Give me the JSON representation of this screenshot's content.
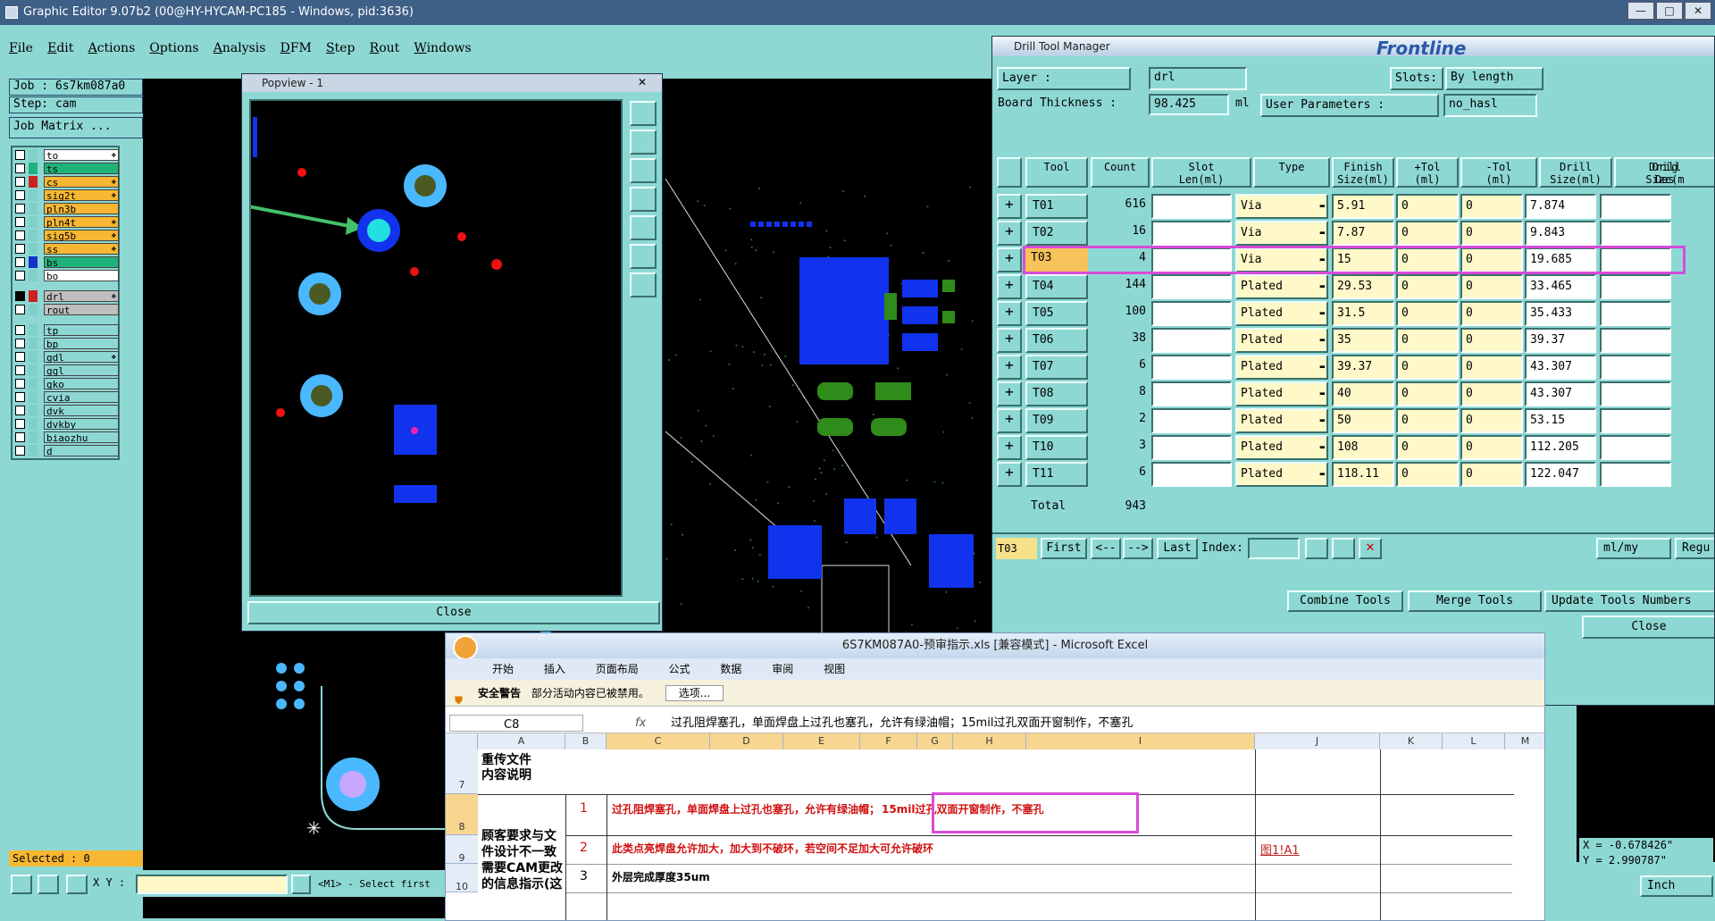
{
  "window": {
    "title": "Graphic Editor 9.07b2 (00@HY-HYCAM-PC185 - Windows, pid:3636)",
    "controls": [
      "—",
      "□",
      "✕"
    ]
  },
  "menu": [
    "File",
    "Edit",
    "Actions",
    "Options",
    "Analysis",
    "DFM",
    "Step",
    "Rout",
    "Windows"
  ],
  "job_info": {
    "job": "Job : 6s7km087a0",
    "step": "Step: cam",
    "matrix_button": "Job Matrix ..."
  },
  "layers": [
    {
      "name": "to",
      "color": "#ffffff",
      "sw": "#7fd0c8",
      "mark": "❖"
    },
    {
      "name": "ts",
      "color": "#1fb27a",
      "sw": "#1fb27a",
      "mark": ""
    },
    {
      "name": "cs",
      "color": "#f7b733",
      "sw": "#cc2222",
      "mark": "❖"
    },
    {
      "name": "sig2t",
      "color": "#f7b733",
      "sw": "#7fd0c8",
      "mark": "❖"
    },
    {
      "name": "pln3b",
      "color": "#f7b733",
      "sw": "#7fd0c8",
      "mark": ""
    },
    {
      "name": "pln4t",
      "color": "#f7b733",
      "sw": "#7fd0c8",
      "mark": "❖"
    },
    {
      "name": "sig5b",
      "color": "#f7b733",
      "sw": "#7fd0c8",
      "mark": "❖"
    },
    {
      "name": "ss",
      "color": "#f7b733",
      "sw": "#7fd0c8",
      "mark": "❖"
    },
    {
      "name": "bs",
      "color": "#1fb27a",
      "sw": "#1133cc",
      "mark": ""
    },
    {
      "name": "bo",
      "color": "#ffffff",
      "sw": "#7fd0c8",
      "mark": ""
    },
    {
      "name": "drl",
      "color": "#bfbfbf",
      "sw": "#cc2222",
      "mark": "❖"
    },
    {
      "name": "rout",
      "color": "#bfbfbf",
      "sw": "#7fd0c8",
      "mark": ""
    },
    {
      "name": "tp",
      "color": "#8ed8d4",
      "sw": "#7fd0c8",
      "mark": ""
    },
    {
      "name": "bp",
      "color": "#8ed8d4",
      "sw": "#7fd0c8",
      "mark": ""
    },
    {
      "name": "gdl",
      "color": "#8ed8d4",
      "sw": "#7fd0c8",
      "mark": "❖"
    },
    {
      "name": "ggl",
      "color": "#8ed8d4",
      "sw": "#7fd0c8",
      "mark": ""
    },
    {
      "name": "gko",
      "color": "#8ed8d4",
      "sw": "#7fd0c8",
      "mark": ""
    },
    {
      "name": "cvia",
      "color": "#8ed8d4",
      "sw": "#7fd0c8",
      "mark": ""
    },
    {
      "name": "dvk",
      "color": "#8ed8d4",
      "sw": "#7fd0c8",
      "mark": ""
    },
    {
      "name": "dvkby",
      "color": "#8ed8d4",
      "sw": "#7fd0c8",
      "mark": ""
    },
    {
      "name": "biaozhu",
      "color": "#8ed8d4",
      "sw": "#7fd0c8",
      "mark": ""
    },
    {
      "name": "d",
      "color": "#8ed8d4",
      "sw": "#7fd0c8",
      "mark": ""
    }
  ],
  "status": {
    "selected": "Selected : 0",
    "xy_label": "X Y :",
    "xy_value": "",
    "prompt": "<M1> - Select first"
  },
  "popview": {
    "title": "Popview - 1",
    "close_x": "✕",
    "close_button": "Close"
  },
  "drill": {
    "title": "Drill Tool Manager",
    "logo_text": "Frontline",
    "layer_label": "Layer          :",
    "layer_value": "drl",
    "slots_label": "Slots:",
    "slots_value": "By length",
    "board_thickness_label": "Board Thickness :",
    "board_thickness_value": "98.425",
    "board_thickness_unit": "ml",
    "user_params_label": "User Parameters :",
    "user_params_value": "no_hasl",
    "headers": [
      "Tool",
      "Count",
      "Slot\nLen(ml)",
      "Type",
      "Finish\nSize(ml)",
      "+Tol\n(ml)",
      "-Tol\n(ml)",
      "Drill\nSize(ml)",
      "Drill\nDes",
      "Orig\nSize(m"
    ],
    "rows": [
      {
        "tool": "T01",
        "count": "616",
        "type": "Via",
        "finish": "5.91",
        "ptol": "0",
        "ntol": "0",
        "drill": "7.874"
      },
      {
        "tool": "T02",
        "count": "16",
        "type": "Via",
        "finish": "7.87",
        "ptol": "0",
        "ntol": "0",
        "drill": "9.843"
      },
      {
        "tool": "T03",
        "count": "4",
        "type": "Via",
        "finish": "15",
        "ptol": "0",
        "ntol": "0",
        "drill": "19.685"
      },
      {
        "tool": "T04",
        "count": "144",
        "type": "Plated",
        "finish": "29.53",
        "ptol": "0",
        "ntol": "0",
        "drill": "33.465"
      },
      {
        "tool": "T05",
        "count": "100",
        "type": "Plated",
        "finish": "31.5",
        "ptol": "0",
        "ntol": "0",
        "drill": "35.433"
      },
      {
        "tool": "T06",
        "count": "38",
        "type": "Plated",
        "finish": "35",
        "ptol": "0",
        "ntol": "0",
        "drill": "39.37"
      },
      {
        "tool": "T07",
        "count": "6",
        "type": "Plated",
        "finish": "39.37",
        "ptol": "0",
        "ntol": "0",
        "drill": "43.307"
      },
      {
        "tool": "T08",
        "count": "8",
        "type": "Plated",
        "finish": "40",
        "ptol": "0",
        "ntol": "0",
        "drill": "43.307"
      },
      {
        "tool": "T09",
        "count": "2",
        "type": "Plated",
        "finish": "50",
        "ptol": "0",
        "ntol": "0",
        "drill": "53.15"
      },
      {
        "tool": "T10",
        "count": "3",
        "type": "Plated",
        "finish": "108",
        "ptol": "0",
        "ntol": "0",
        "drill": "112.205"
      },
      {
        "tool": "T11",
        "count": "6",
        "type": "Plated",
        "finish": "118.11",
        "ptol": "0",
        "ntol": "0",
        "drill": "122.047"
      }
    ],
    "total_label": "Total",
    "total_value": "943",
    "nav": {
      "current": "T03",
      "first": "First",
      "prev": "<--",
      "next": "-->",
      "last": "Last",
      "index_label": "Index:",
      "units": "ml/my",
      "regu": "Regu"
    },
    "buttons": {
      "combine": "Combine Tools",
      "merge": "Merge Tools",
      "update": "Update Tools Numbers",
      "close": "Close"
    },
    "coords": {
      "x": "X = -0.678426\"",
      "y": "Y =  2.990787\""
    },
    "inch": "Inch"
  },
  "excel": {
    "title": "6S7KM087A0-预审指示.xls  [兼容模式] - Microsoft Excel",
    "tabs": [
      "开始",
      "插入",
      "页面布局",
      "公式",
      "数据",
      "审阅",
      "视图"
    ],
    "warning_title": "安全警告",
    "warning_text": "部分活动内容已被禁用。",
    "options_button": "选项...",
    "cell_ref": "C8",
    "fx": "fx",
    "formula": "过孔阻焊塞孔，单面焊盘上过孔也塞孔，允许有绿油帽；15mil过孔双面开窗制作，不塞孔",
    "columns": [
      "A",
      "B",
      "C",
      "D",
      "E",
      "F",
      "G",
      "H",
      "I",
      "J",
      "K",
      "L",
      "M"
    ],
    "row_numbers": [
      "7",
      "8",
      "9",
      "10"
    ],
    "a7": "重传文件\n内容说明",
    "a8": "顾客要求与文\n件设计不一致\n需要CAM更改\n的信息指示(这",
    "items": [
      {
        "n": "1",
        "text": "过孔阻焊塞孔，单面焊盘上过孔也塞孔，允许有绿油帽；",
        "highlight": "15mil过孔双面开窗制作，不塞孔",
        "link": ""
      },
      {
        "n": "2",
        "text": "此类点亮焊盘允许加大，加大到不破环，若空间不足加大可允许破环",
        "highlight": "",
        "link": "图1!A1"
      },
      {
        "n": "3",
        "text": "外层完成厚度35um",
        "highlight": "",
        "link": ""
      }
    ]
  }
}
